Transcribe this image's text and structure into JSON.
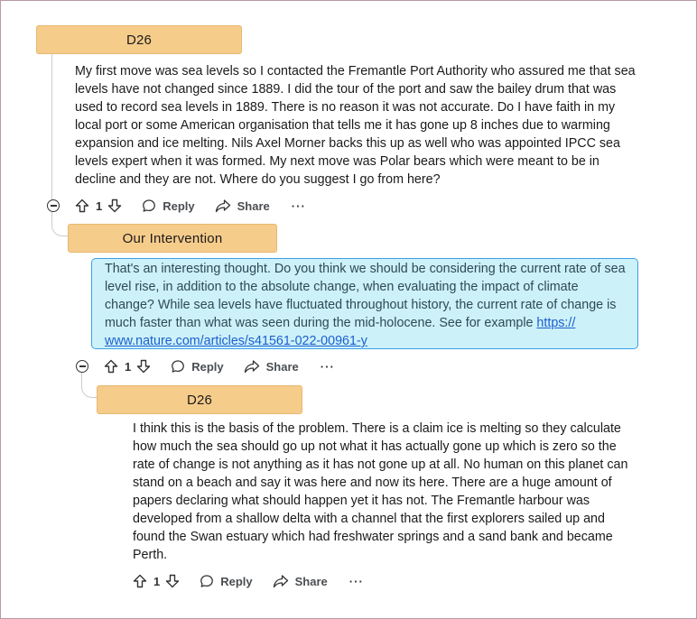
{
  "comments": [
    {
      "author": "D26",
      "text": "My first move was sea levels so I contacted the Fremantle Port Authority who assured me that sea levels have not changed since 1889. I did the tour of the port and saw the bailey drum that was used to record sea levels in 1889. There is no reason it was not accurate. Do I have faith in my local port or some American organisation that tells me it has gone up 8 inches due to warming expansion and ice melting. Nils Axel Morner backs this up as well who was appointed IPCC sea levels expert when it was formed. My next move was Polar bears which were meant to be in decline and they are not. Where do you suggest I go from here?",
      "votes": "1",
      "reply_label": "Reply",
      "share_label": "Share",
      "more_label": "···"
    },
    {
      "author": "Our Intervention",
      "text": "That's an interesting thought. Do you think we should be considering the current rate of sea level rise, in addition to the absolute change, when evaluating the impact of climate change? While sea levels have fluctuated throughout history, the current rate of change is much faster than what was seen during the mid-holocene. See for example ",
      "link_text": "https://www.nature.com/articles/s41561-022-00961-y",
      "link_line1": "https://",
      "link_line2": "www.nature.com/articles/s41561-022-00961-y",
      "votes": "1",
      "reply_label": "Reply",
      "share_label": "Share",
      "more_label": "···"
    },
    {
      "author": "D26",
      "text": "I think this is the basis of the problem. There is a claim ice is melting so they calculate how much the sea should go up not what it has actually gone up which is zero so the rate of change is not anything as it has not gone up at all. No human on this planet can stand on a beach and say it was here and now its here. There are a huge amount of papers declaring what should happen yet it has not. The Fremantle harbour was developed from a shallow delta with a channel that the first explorers sailed up and found the Swan estuary which had freshwater springs and a sand bank and became Perth.",
      "votes": "1",
      "reply_label": "Reply",
      "share_label": "Share",
      "more_label": "···"
    }
  ],
  "colors": {
    "author_tag": "#f6cc8b",
    "highlight_bg": "#cdf1f8",
    "highlight_border": "#3aa0e8",
    "link": "#1a5fd0"
  },
  "icons": [
    "upvote-icon",
    "downvote-icon",
    "reply-icon",
    "share-icon",
    "collapse-icon",
    "more-icon"
  ]
}
